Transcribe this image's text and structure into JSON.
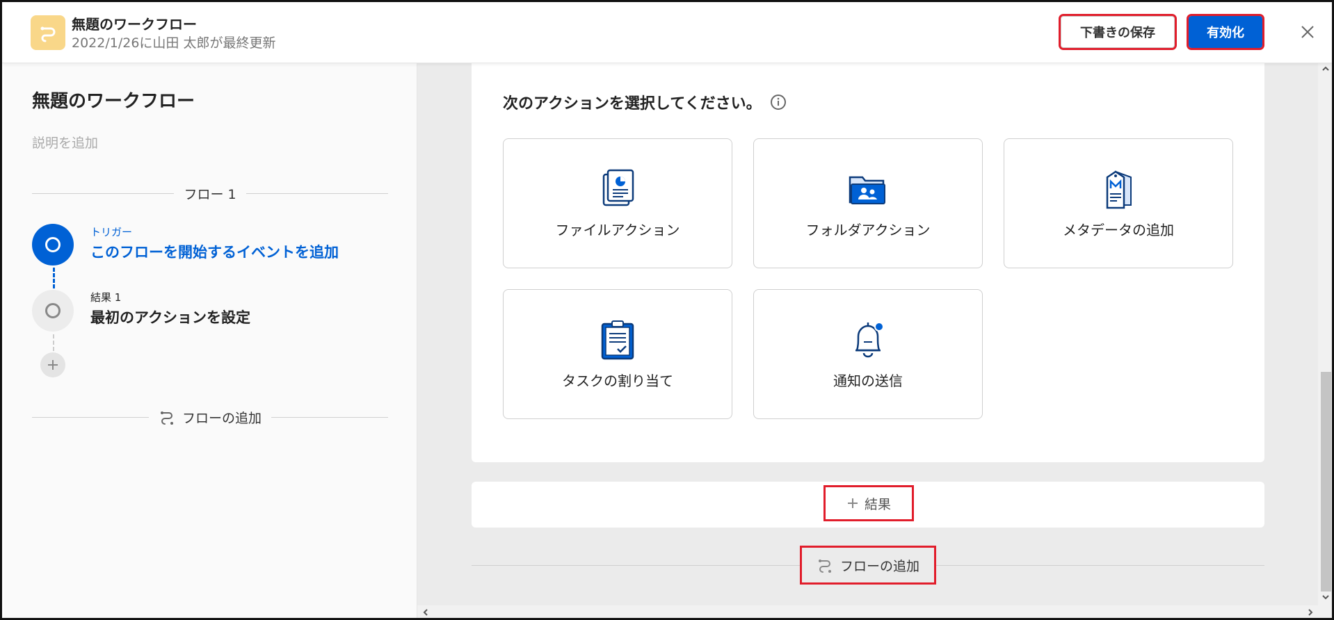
{
  "header": {
    "title": "無題のワークフロー",
    "subtitle": "2022/1/26に山田 太郎が最終更新",
    "save_draft": "下書きの保存",
    "activate": "有効化"
  },
  "sidebar": {
    "title": "無題のワークフロー",
    "description_placeholder": "説明を追加",
    "flow_label": "フロー 1",
    "trigger": {
      "small": "トリガー",
      "main": "このフローを開始するイベントを追加"
    },
    "result": {
      "small": "結果 1",
      "main": "最初のアクションを設定"
    },
    "add_flow": "フローの追加"
  },
  "canvas": {
    "prompt": "次のアクションを選択してください。",
    "actions": [
      {
        "label": "ファイルアクション",
        "icon": "file-report-icon"
      },
      {
        "label": "フォルダアクション",
        "icon": "folder-users-icon"
      },
      {
        "label": "メタデータの追加",
        "icon": "metadata-tag-icon"
      },
      {
        "label": "タスクの割り当て",
        "icon": "clipboard-task-icon"
      },
      {
        "label": "通知の送信",
        "icon": "bell-icon"
      }
    ],
    "add_result": "結果",
    "add_flow": "フローの追加"
  },
  "colors": {
    "primary": "#0061d5",
    "highlight": "#e11d2b",
    "app_icon_bg": "#f9d789"
  }
}
